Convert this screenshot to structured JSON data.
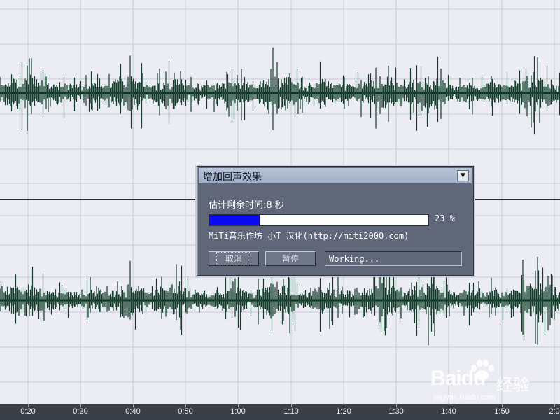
{
  "waveform": {
    "background": "#ecedf4",
    "grid_color": "#c9cbd3",
    "wave_color": "#143d2c",
    "channels": [
      "channel-top",
      "channel-bottom"
    ]
  },
  "timeline": {
    "labels": [
      "0:20",
      "0:30",
      "0:40",
      "0:50",
      "1:00",
      "1:10",
      "1:20",
      "1:30",
      "1:40",
      "1:50",
      "2:0"
    ]
  },
  "dialog": {
    "title": "增加回声效果",
    "estimate_text": "估计剩余时间:8 秒",
    "progress": 23,
    "percent_text": "23 %",
    "credit_text": "MiTi音乐作坊 小T 汉化(http://miti2000.com)",
    "cancel_label": "取消",
    "pause_label": "暂停",
    "status_text": "Working...",
    "dropdown_icon": "chevron-down-icon"
  },
  "watermark": {
    "logo": "Baidu",
    "cn": "经验",
    "url": "jingyan.baidu.com"
  }
}
